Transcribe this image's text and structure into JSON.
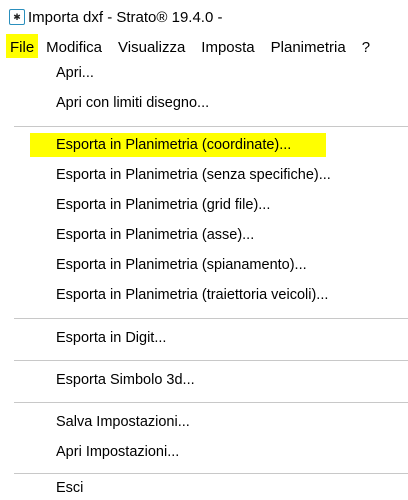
{
  "window": {
    "title": "Importa dxf - Strato® 19.4.0 -",
    "icon": "strato-app-icon"
  },
  "menubar": {
    "items": [
      "File",
      "Modifica",
      "Visualizza",
      "Imposta",
      "Planimetria",
      "?"
    ],
    "active": "File",
    "highlight_color": "#ffff00"
  },
  "file_menu": {
    "items": [
      "Apri...",
      "Apri con limiti disegno...",
      "Esporta in Planimetria (coordinate)...",
      "Esporta in Planimetria (senza specifiche)...",
      "Esporta in Planimetria (grid file)...",
      "Esporta in Planimetria (asse)...",
      "Esporta in Planimetria (spianamento)...",
      "Esporta in Planimetria (traiettoria veicoli)...",
      "Esporta in Digit...",
      "Esporta Simbolo 3d...",
      "Salva Impostazioni...",
      "Apri Impostazioni...",
      "Esci"
    ],
    "highlighted": "Esporta in Planimetria (coordinate)..."
  }
}
